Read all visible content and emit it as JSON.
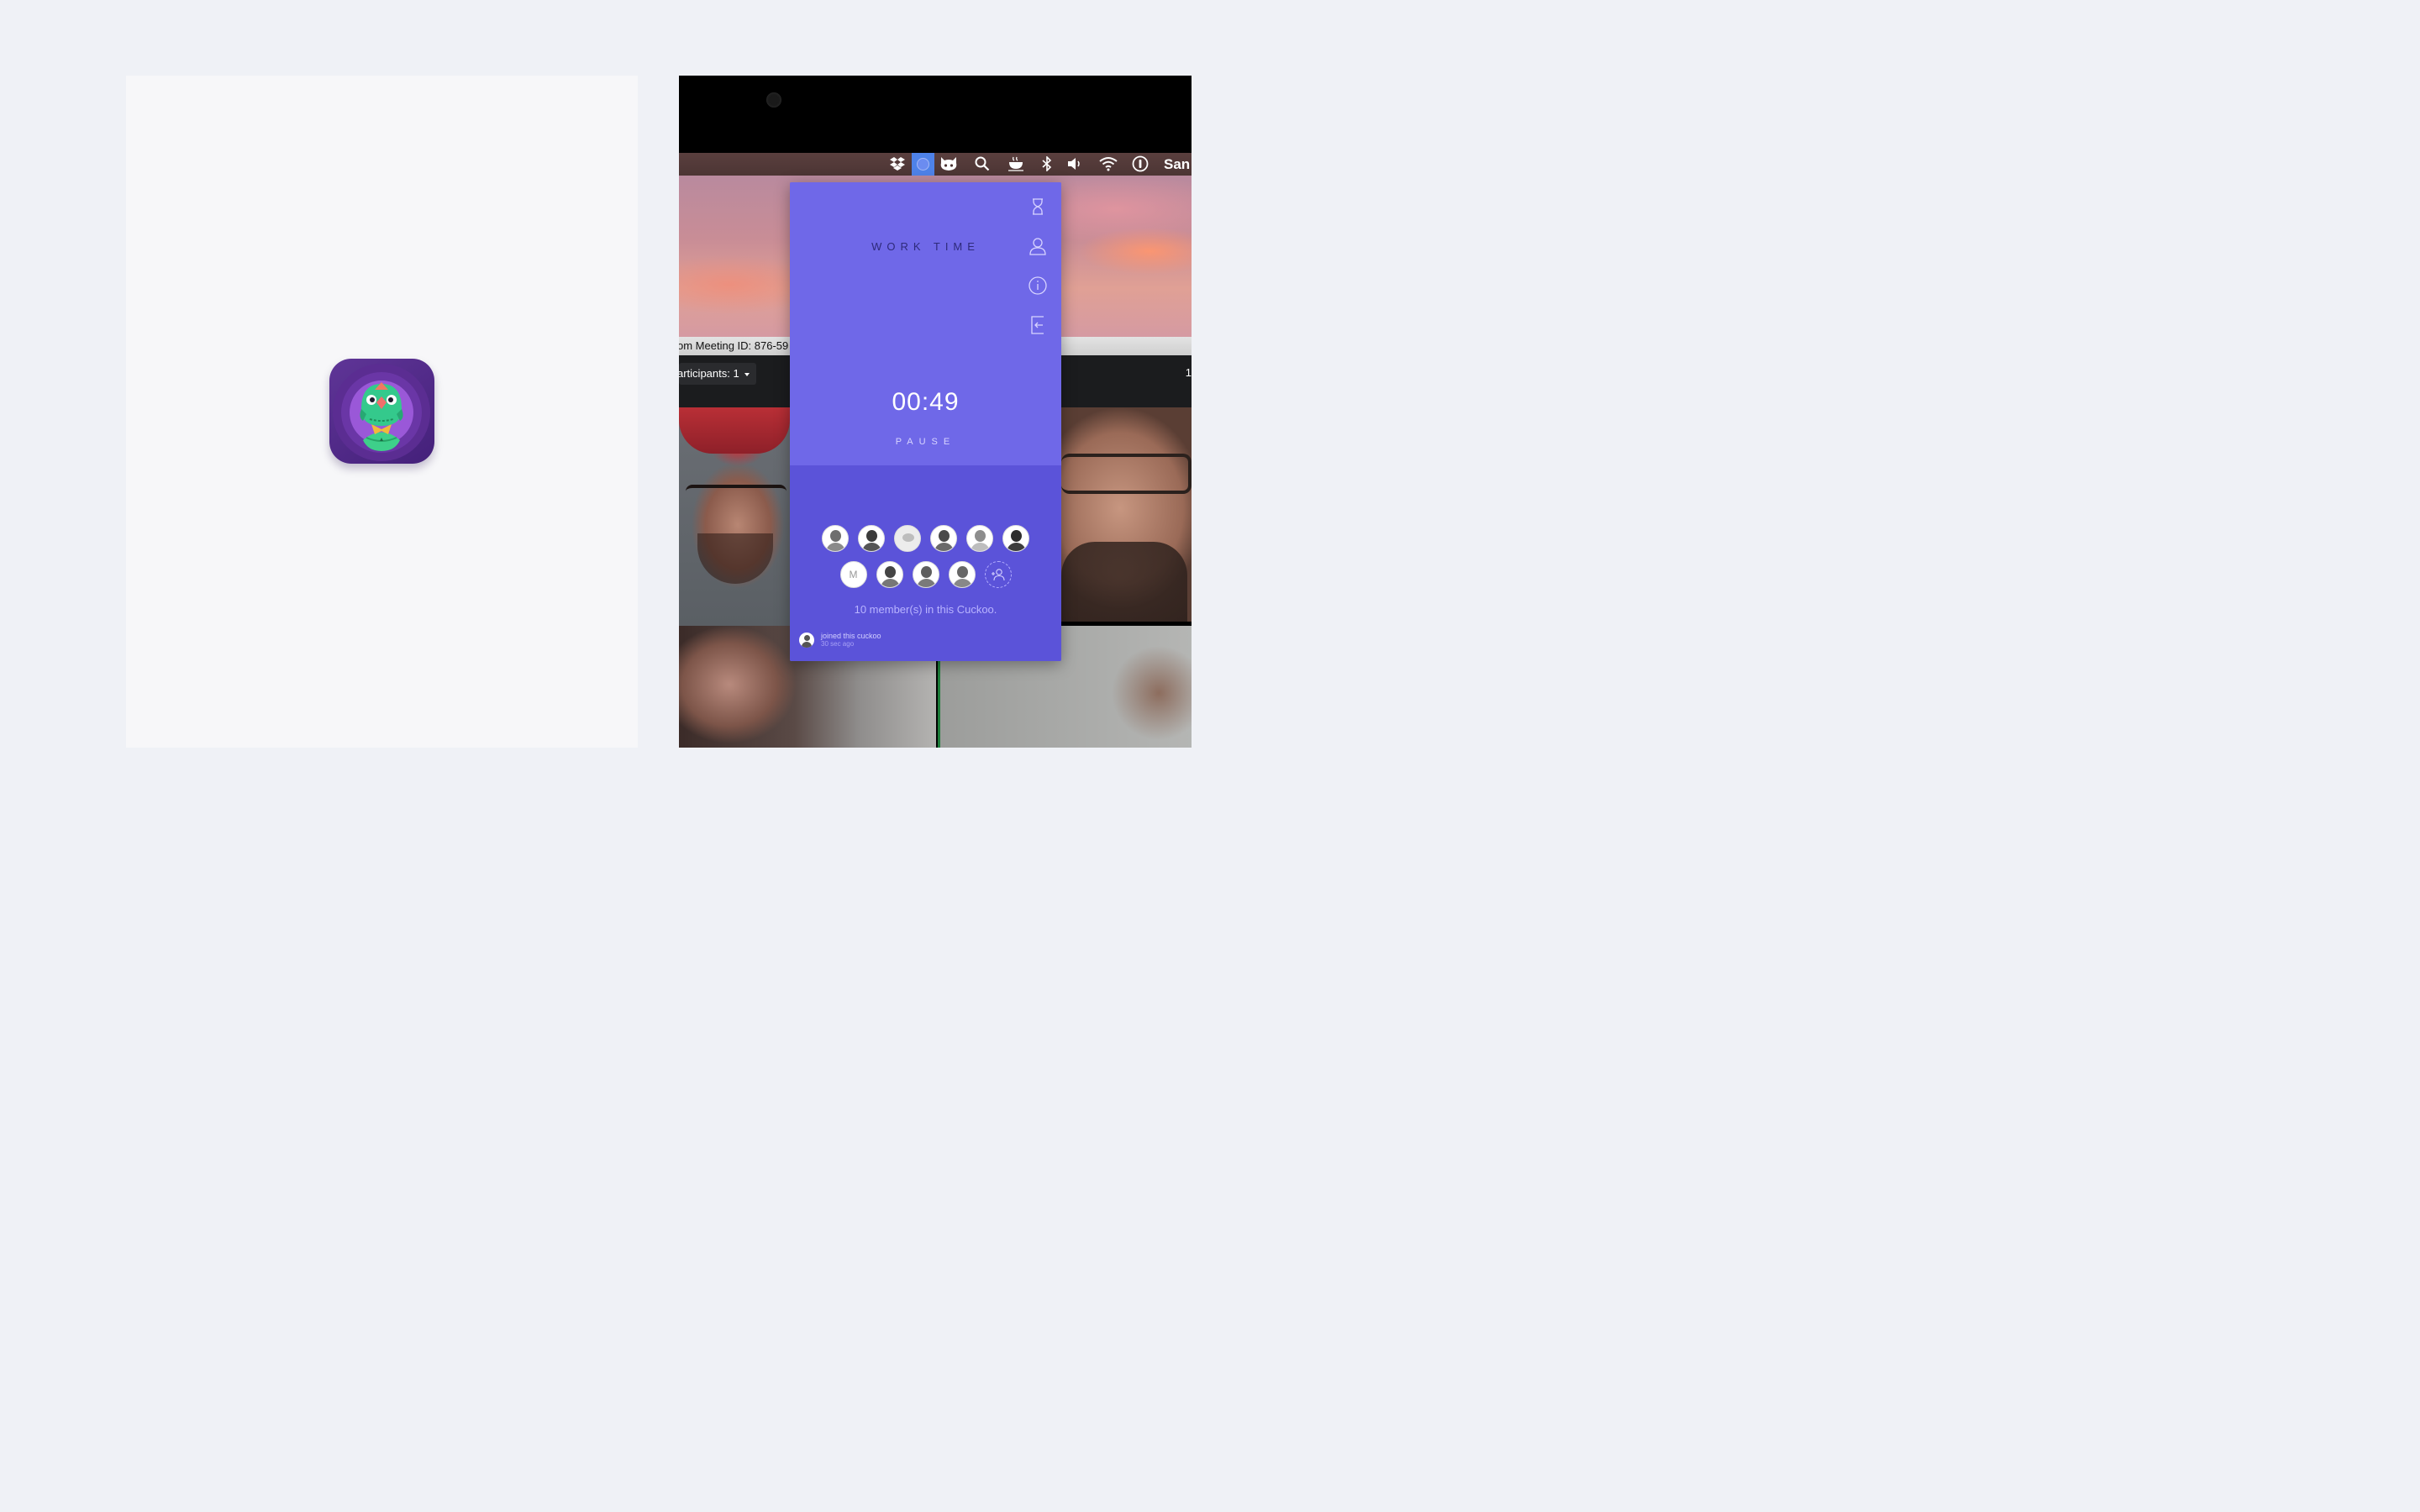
{
  "menubar": {
    "icons": [
      "dropbox-icon",
      "cuckoo-icon",
      "github-icon",
      "search-icon",
      "coffee-icon",
      "bluetooth-icon",
      "volume-icon",
      "wifi-icon",
      "info-icon"
    ],
    "clock_text": "San"
  },
  "zoom": {
    "meeting_id": "om Meeting ID: 876-59",
    "participants": "articipants: 1",
    "right_count": "1"
  },
  "popup": {
    "mode_title": "WORK TIME",
    "timer": "00:49",
    "pause_label": "PAUSE",
    "side_icons": [
      "hourglass-icon",
      "user-icon",
      "info-icon",
      "exit-icon"
    ],
    "avatar_letter": "M",
    "members_text": "10 member(s) in this Cuckoo.",
    "activity_text": "joined this cuckoo",
    "activity_time": "30 sec ago",
    "accent_color": "#6f68e8",
    "accent_dark": "#5b53d9"
  }
}
